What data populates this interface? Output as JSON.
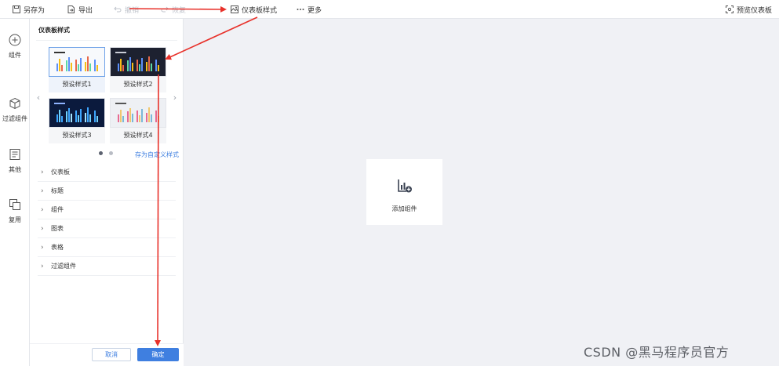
{
  "toolbar": {
    "save_as": "另存为",
    "export": "导出",
    "undo": "撤销",
    "redo": "恢复",
    "dashboard_style": "仪表板样式",
    "more": "更多",
    "preview": "预览仪表板"
  },
  "rail": {
    "items": [
      {
        "label": "组件",
        "icon": "plus-circle-icon"
      },
      {
        "label": "过滤组件",
        "icon": "cube-icon"
      },
      {
        "label": "其他",
        "icon": "document-icon"
      },
      {
        "label": "复用",
        "icon": "copy-icon"
      }
    ]
  },
  "panel": {
    "title": "仪表板样式",
    "presets": [
      {
        "label": "预设样式1",
        "theme": "light"
      },
      {
        "label": "预设样式2",
        "theme": "dark"
      },
      {
        "label": "预设样式3",
        "theme": "deep-blue"
      },
      {
        "label": "预设样式4",
        "theme": "light-grey"
      }
    ],
    "save_custom": "存为自定义样式",
    "sections": [
      "仪表板",
      "标题",
      "组件",
      "图表",
      "表格",
      "过滤组件"
    ],
    "cancel": "取消",
    "confirm": "确定"
  },
  "canvas": {
    "add_component": "添加组件"
  },
  "watermark": "CSDN @黑马程序员官方",
  "colors": {
    "accent": "#3f7fe0",
    "annotation": "#e8312a",
    "canvas_bg": "#f0f1f5"
  }
}
